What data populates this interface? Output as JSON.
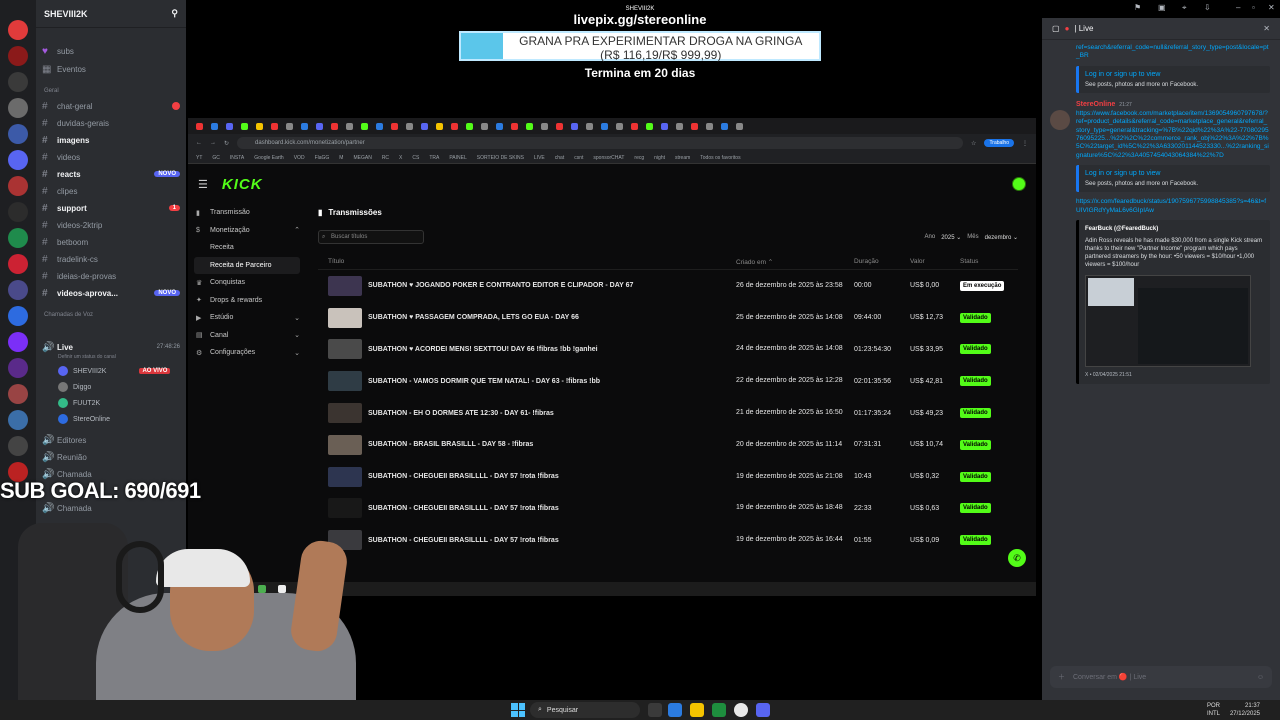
{
  "overlay": {
    "url": "livepix.gg/stereonline",
    "goal_title": "GRANA PRA EXPERIMENTAR DROGA NA GRINGA",
    "goal_amount": "(R$ 116,19/R$ 999,99)",
    "goal_progress": 0.116,
    "goal_deadline": "Termina em 20 dias",
    "sub_goal": "SUB GOAL: 690/691",
    "tiny_name": "SHEVIII2K"
  },
  "discord": {
    "server_name": "SHEVIII2K",
    "channels": [
      {
        "name": "subs",
        "icon": "hash-icon"
      },
      {
        "name": "Eventos",
        "icon": "calendar-icon"
      }
    ],
    "category_geral": "Geral",
    "text_channels": [
      {
        "name": "chat-geral",
        "badge": "4"
      },
      {
        "name": "duvidas-gerais",
        "badge": ""
      },
      {
        "name": "imagens",
        "badge": ""
      },
      {
        "name": "videos",
        "badge": ""
      },
      {
        "name": "reacts",
        "badge": "NOVO"
      },
      {
        "name": "clipes",
        "badge": ""
      },
      {
        "name": "support",
        "badge": "1"
      },
      {
        "name": "videos-2ktrip",
        "badge": ""
      },
      {
        "name": "betboom",
        "badge": ""
      },
      {
        "name": "tradelink-cs",
        "badge": ""
      },
      {
        "name": "ideias-de-provas",
        "badge": ""
      },
      {
        "name": "videos-aprova...",
        "badge": "NOVO"
      }
    ],
    "category_voice": "Chamadas de Voz",
    "voice_channel": "Live",
    "voice_status": "Definir um status do canal",
    "voice_time": "27:48:26",
    "voice_users": [
      {
        "name": "SHEVIII2K",
        "live": "AO VIVO"
      },
      {
        "name": "Diggo",
        "live": ""
      },
      {
        "name": "FUUT2K",
        "live": ""
      },
      {
        "name": "StereOnline",
        "live": ""
      }
    ],
    "other_channels": [
      "Editores",
      "Reunião",
      "Chamada",
      "Chamada"
    ]
  },
  "browser": {
    "address": "dashboard.kick.com/monetization/partner",
    "profile": "Trabalho",
    "bookmarks": [
      "YT",
      "GC",
      "INSTA",
      "Google Earth",
      "VOD",
      "FlaGG",
      "M",
      "MEGAN",
      "RC",
      "X",
      "CS",
      "TRA",
      "PAINEL",
      "SORTEIO DE SKINS",
      "LIVE",
      "chat",
      "csnt",
      "sponsorCHAT",
      "recg",
      "night",
      "stream",
      "Todos os favoritos"
    ]
  },
  "kick": {
    "logo": "KICK",
    "nav": [
      {
        "label": "Transmissão",
        "icon": "broadcast-icon",
        "chevron": false,
        "sub": false,
        "active": false
      },
      {
        "label": "Monetização",
        "icon": "dollar-icon",
        "chevron": "up",
        "sub": false,
        "active": false
      },
      {
        "label": "Receita",
        "icon": "",
        "chevron": false,
        "sub": true,
        "active": false
      },
      {
        "label": "Receita de Parceiro",
        "icon": "",
        "chevron": false,
        "sub": true,
        "active": true
      },
      {
        "label": "Conquistas",
        "icon": "trophy-icon",
        "chevron": false,
        "sub": false,
        "active": false
      },
      {
        "label": "Drops & rewards",
        "icon": "gift-icon",
        "chevron": false,
        "sub": false,
        "active": false
      },
      {
        "label": "Estúdio",
        "icon": "studio-icon",
        "chevron": "down",
        "sub": false,
        "active": false
      },
      {
        "label": "Canal",
        "icon": "channel-icon",
        "chevron": "down",
        "sub": false,
        "active": false
      },
      {
        "label": "Configurações",
        "icon": "gear-icon",
        "chevron": "down",
        "sub": false,
        "active": false
      }
    ],
    "page_title": "Transmissões",
    "search_placeholder": "Buscar títulos",
    "year_label": "Ano",
    "year_value": "2025",
    "month_label": "Mês",
    "month_value": "dezembro",
    "columns": [
      "Título",
      "Criado em",
      "Duração",
      "Valor",
      "Status"
    ],
    "rows": [
      {
        "title": "SUBATHON ♥ JOGANDO POKER E CONTRANTO EDITOR E CLIPADOR - DAY 67",
        "date": "26 de dezembro de 2025 às 23:58",
        "duration": "00:00",
        "value": "US$ 0,00",
        "status": "Em execução",
        "thumb": "#3d3550"
      },
      {
        "title": "SUBATHON ♥ PASSAGEM COMPRADA, LETS GO EUA - DAY 66",
        "date": "25 de dezembro de 2025 às 14:08",
        "duration": "09:44:00",
        "value": "US$ 12,73",
        "status": "Validado",
        "thumb": "#c9c2bb"
      },
      {
        "title": "SUBATHON ♥ ACORDEI MENS! SEXTTOU! DAY 66 !fibras !bb !ganhei",
        "date": "24 de dezembro de 2025 às 14:08",
        "duration": "01:23:54:30",
        "value": "US$ 33,95",
        "status": "Validado",
        "thumb": "#4a4a4a"
      },
      {
        "title": "SUBATHON - VAMOS DORMIR QUE TEM NATAL! - DAY 63 - !fibras !bb",
        "date": "22 de dezembro de 2025 às 12:28",
        "duration": "02:01:35:56",
        "value": "US$ 42,81",
        "status": "Validado",
        "thumb": "#2f3c45"
      },
      {
        "title": "SUBATHON - EH O DORMES ATE 12:30 - DAY 61- !fibras",
        "date": "21 de dezembro de 2025 às 16:50",
        "duration": "01:17:35:24",
        "value": "US$ 49,23",
        "status": "Validado",
        "thumb": "#3b3430"
      },
      {
        "title": "SUBATHON - BRASIL BRASILLL - DAY 58 - !fibras",
        "date": "20 de dezembro de 2025 às 11:14",
        "duration": "07:31:31",
        "value": "US$ 10,74",
        "status": "Validado",
        "thumb": "#6a5f55"
      },
      {
        "title": "SUBATHON - CHEGUEII BRASILLLL - DAY 57 !rota !fibras",
        "date": "19 de dezembro de 2025 às 21:08",
        "duration": "10:43",
        "value": "US$ 0,32",
        "status": "Validado",
        "thumb": "#2d3550"
      },
      {
        "title": "SUBATHON - CHEGUEII BRASILLLL - DAY 57 !rota !fibras",
        "date": "19 de dezembro de 2025 às 18:48",
        "duration": "22:33",
        "value": "US$ 0,63",
        "status": "Validado",
        "thumb": "#181818"
      },
      {
        "title": "SUBATHON - CHEGUEII BRASILLLL - DAY 57 !rota !fibras",
        "date": "19 de dezembro de 2025 às 16:44",
        "duration": "01:55",
        "value": "US$ 0,09",
        "status": "Validado",
        "thumb": "#3a3a3e"
      }
    ]
  },
  "chat": {
    "channel": "Live",
    "link1": "ref=search&referral_code=null&referral_story_type=post&locale=pt_BR",
    "fb_embed_link": "Log in or sign up to view",
    "fb_embed_text": "See posts, photos and more on Facebook.",
    "author": "StereOnline",
    "author_time": "21:27",
    "link2": "https://www.facebook.com/marketplace/item/1369054960797678/?ref=product_details&referral_code=marketplace_general&referral_story_type=general&tracking=%7B%22qid%22%3A%22-7708029576095225...%22%2C%22commerce_rank_obj%22%3A%22%7B%5C%22target_id%5C%22%3A6330201144523330...%22ranking_signature%5C%22%3A4057454043064384%22%7D",
    "fb_embed_link2": "Log in or sign up to view",
    "fb_embed_text2": "See posts, photos and more on Facebook.",
    "link3": "https://x.com/fearedbuck/status/1907596775998845385?s=46&t=fUIVIGRdYyMaL6v6GIpIAw",
    "tweet_author": "FearBuck (@FearedBuck)",
    "tweet_text": "Adin Ross reveals he has made $30,000 from a single Kick stream thanks to their new \"Partner Income\" program which pays partnered streamers by the hour: •50 viewers = $10/hour •1,000 viewers = $100/hour",
    "tweet_footer": "X • 02/04/2025 21:51",
    "input_placeholder": "Conversar em 🔴 | Live"
  },
  "taskbar": {
    "search": "Pesquisar",
    "lang_top": "POR",
    "lang_bottom": "INTL",
    "time": "21:37",
    "date": "27/12/2025"
  }
}
